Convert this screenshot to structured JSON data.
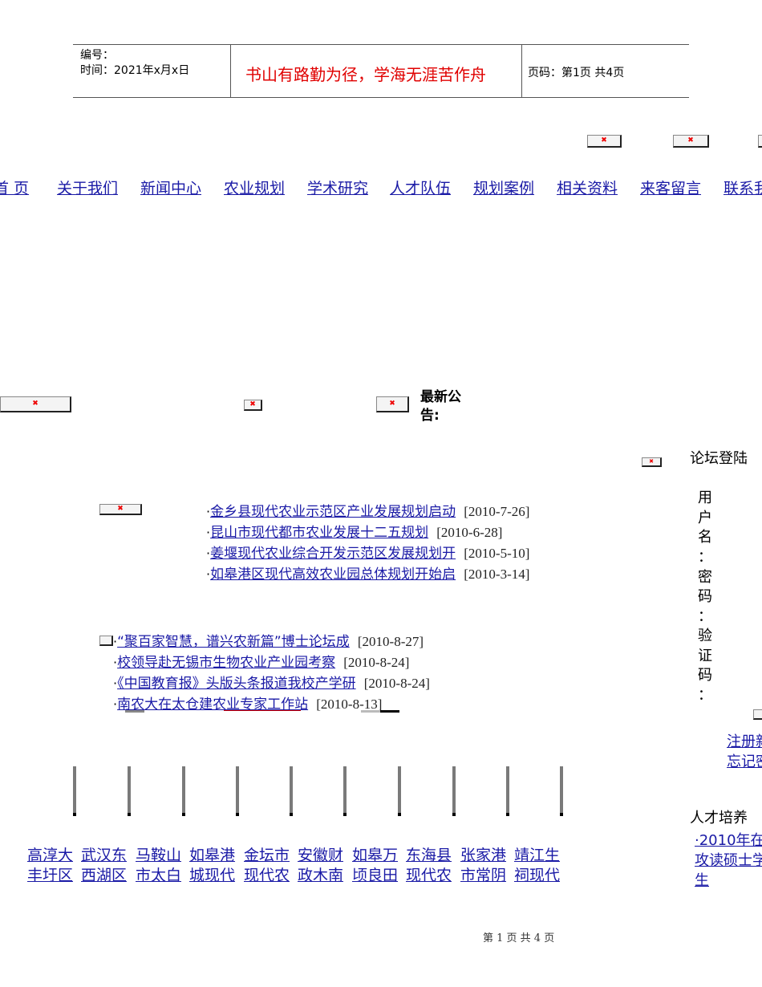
{
  "header": {
    "number_label": "编号：",
    "time_label": "时间：2021年x月x日",
    "motto": "书山有路勤为径，学海无涯苦作舟",
    "page_label": "页码：第1页  共4页"
  },
  "nav": [
    "首 页",
    "关于我们",
    "新闻中心",
    "农业规划",
    "学术研究",
    "人才队伍",
    "规划案例",
    "相关资料",
    "来客留言",
    "联系我们"
  ],
  "announcement_title": "最新公告:",
  "news_top": [
    {
      "title": "金乡县现代农业示范区产业发展规划启动",
      "date": "[2010-7-26]"
    },
    {
      "title": "昆山市现代都市农业发展十二五规划",
      "date": "[2010-6-28]"
    },
    {
      "title": "姜堰现代农业综合开发示范区发展规划开",
      "date": "[2010-5-10]"
    },
    {
      "title": "如皋港区现代高效农业园总体规划开始启",
      "date": "[2010-3-14]"
    }
  ],
  "news_bottom": [
    {
      "title": "“聚百家智慧，谱兴农新篇”博士论坛成",
      "date": "[2010-8-27]"
    },
    {
      "title": "校领导赴无锡市生物农业产业园考察",
      "date": "[2010-8-24]"
    },
    {
      "title": "《中国教育报》头版头条报道我校产学研",
      "date": "[2010-8-24]"
    },
    {
      "title": "南农大在太仓建农业专家工作站",
      "date": "[2010-8-13]"
    }
  ],
  "cases_row1": [
    "高淳大",
    "武汉东",
    "马鞍山",
    "如皋港",
    "金坛市",
    "安徽财",
    "如皋万",
    "东海县",
    "张家港",
    "靖江生"
  ],
  "cases_row2": [
    "丰圩区",
    "西湖区",
    "市太白",
    "城现代",
    "现代农",
    "政木南",
    "顷良田",
    "现代农",
    "市常阴",
    "祠现代"
  ],
  "forum": {
    "title": "论坛登陆",
    "labels": [
      "用",
      "户",
      "名",
      "：",
      "密",
      "码",
      "：",
      "验",
      "证",
      "码",
      "："
    ],
    "register": "注册新",
    "forgot": "忘记密"
  },
  "talent": {
    "title": "人才培养",
    "lines": [
      "·2010年在",
      "攻读硕士学",
      "生"
    ]
  },
  "footer": "第 1 页 共 4 页"
}
